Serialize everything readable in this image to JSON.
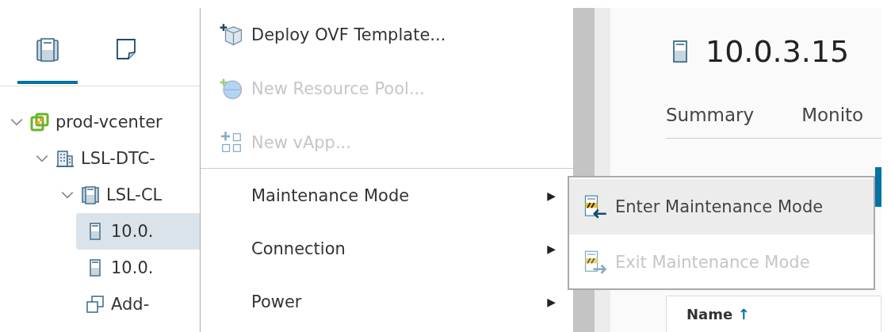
{
  "sidebar": {
    "tabs": [
      {
        "kind": "hosts",
        "selected": true
      },
      {
        "kind": "vms",
        "selected": false
      }
    ],
    "tree": [
      {
        "label": "prod-vcenter",
        "kind": "vcenter",
        "expanded": true,
        "selected": false,
        "children": [
          {
            "label": "LSL-DTC-",
            "kind": "datacenter",
            "expanded": true,
            "selected": false,
            "children": [
              {
                "label": "LSL-CL",
                "kind": "cluster",
                "expanded": true,
                "selected": false,
                "children": [
                  {
                    "label": "10.0.",
                    "kind": "host",
                    "selected": true
                  },
                  {
                    "label": "10.0.",
                    "kind": "host",
                    "selected": false
                  },
                  {
                    "label": "Add-",
                    "kind": "vapp",
                    "selected": false
                  }
                ]
              }
            ]
          }
        ]
      }
    ]
  },
  "header": {
    "title": "10.0.3.15"
  },
  "tabs": [
    {
      "label": "Summary"
    },
    {
      "label": "Monito"
    }
  ],
  "table": {
    "columns": [
      {
        "label": "Name",
        "sort_icon": "↑"
      }
    ]
  },
  "context_menu": {
    "items": [
      {
        "kind": "action",
        "label": "Deploy OVF Template...",
        "disabled": false
      },
      {
        "kind": "action",
        "label": "New Resource Pool...",
        "disabled": true
      },
      {
        "kind": "action",
        "label": "New vApp...",
        "disabled": true
      },
      {
        "kind": "separator"
      },
      {
        "kind": "submenu",
        "label": "Maintenance Mode",
        "arrow": "▶"
      },
      {
        "kind": "submenu",
        "label": "Connection",
        "arrow": "▶"
      },
      {
        "kind": "submenu",
        "label": "Power",
        "arrow": "▶"
      }
    ]
  },
  "submenu": {
    "items": [
      {
        "label": "Enter Maintenance Mode",
        "disabled": false,
        "hovered": true
      },
      {
        "label": "Exit Maintenance Mode",
        "disabled": true,
        "hovered": false
      }
    ]
  }
}
